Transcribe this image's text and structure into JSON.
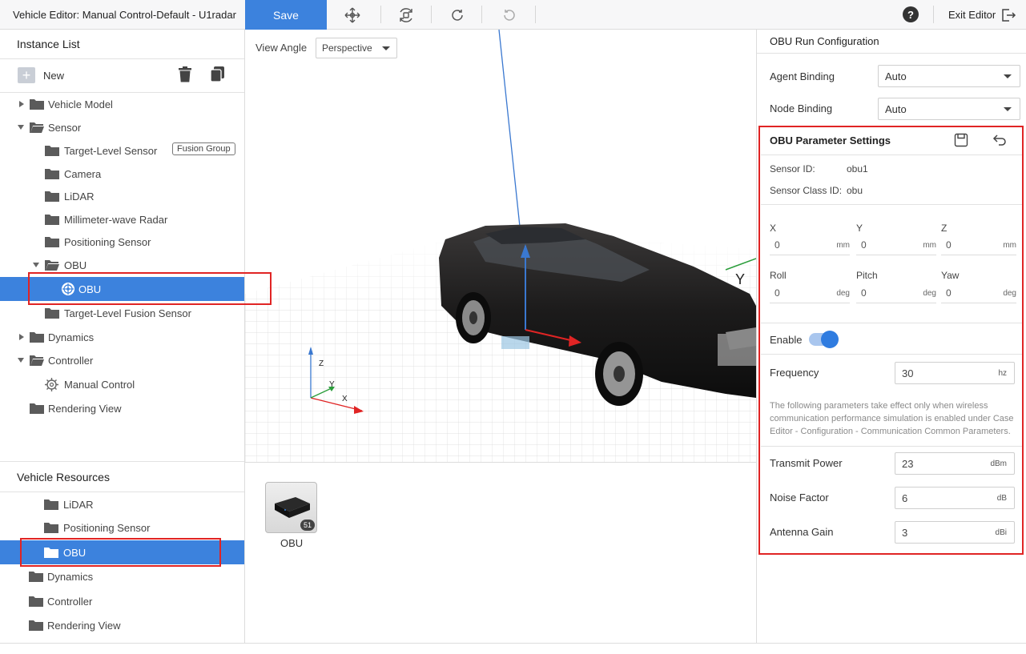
{
  "header": {
    "title": "Vehicle Editor: Manual Control-Default - U1radar",
    "save_label": "Save",
    "exit_label": "Exit Editor",
    "icons": [
      "move-icon",
      "rotate-icon",
      "redo-icon",
      "undo-icon",
      "help-icon",
      "exit-icon"
    ]
  },
  "instance_list": {
    "title": "Instance List",
    "new_label": "New",
    "items": [
      {
        "label": "Vehicle Model"
      },
      {
        "label": "Sensor"
      },
      {
        "label": "Target-Level Sensor",
        "badge": "Fusion Group"
      },
      {
        "label": "Camera"
      },
      {
        "label": "LiDAR"
      },
      {
        "label": "Millimeter-wave Radar"
      },
      {
        "label": "Positioning Sensor"
      },
      {
        "label": "OBU"
      },
      {
        "label": "OBU"
      },
      {
        "label": "Target-Level Fusion Sensor"
      },
      {
        "label": "Dynamics"
      },
      {
        "label": "Controller"
      },
      {
        "label": "Manual Control"
      },
      {
        "label": "Rendering View"
      }
    ]
  },
  "vehicle_resources": {
    "title": "Vehicle Resources",
    "items": [
      {
        "label": "LiDAR"
      },
      {
        "label": "Positioning Sensor"
      },
      {
        "label": "OBU"
      },
      {
        "label": "Dynamics"
      },
      {
        "label": "Controller"
      },
      {
        "label": "Rendering View"
      }
    ]
  },
  "viewport": {
    "view_angle_label": "View Angle",
    "view_angle_value": "Perspective",
    "axis_labels": {
      "z": "Z",
      "y": "Y",
      "x": "X",
      "big_y": "Y"
    }
  },
  "resource_card": {
    "label": "OBU",
    "count": "51"
  },
  "run_config": {
    "title": "OBU Run Configuration",
    "agent_binding_label": "Agent Binding",
    "agent_binding_value": "Auto",
    "node_binding_label": "Node Binding",
    "node_binding_value": "Auto"
  },
  "params": {
    "title": "OBU Parameter Settings",
    "sensor_id_label": "Sensor ID:",
    "sensor_id_value": "obu1",
    "sensor_class_label": "Sensor Class ID:",
    "sensor_class_value": "obu",
    "x_label": "X",
    "y_label": "Y",
    "z_label": "Z",
    "x_val": "0",
    "y_val": "0",
    "z_val": "0",
    "pos_unit": "mm",
    "roll_label": "Roll",
    "pitch_label": "Pitch",
    "yaw_label": "Yaw",
    "roll_val": "0",
    "pitch_val": "0",
    "yaw_val": "0",
    "rot_unit": "deg",
    "enable_label": "Enable",
    "enable_on": true,
    "frequency_label": "Frequency",
    "frequency_value": "30",
    "frequency_unit": "hz",
    "note": "The following parameters take effect only when wireless communication performance simulation is enabled under Case Editor - Configuration - Communication Common Parameters.",
    "transmit_power_label": "Transmit Power",
    "transmit_power_value": "23",
    "transmit_power_unit": "dBm",
    "noise_factor_label": "Noise Factor",
    "noise_factor_value": "6",
    "noise_factor_unit": "dB",
    "antenna_gain_label": "Antenna Gain",
    "antenna_gain_value": "3",
    "antenna_gain_unit": "dBi"
  },
  "colors": {
    "accent": "#3c82dd",
    "highlight": "#e02424",
    "toggle": "#2f7ce0"
  }
}
